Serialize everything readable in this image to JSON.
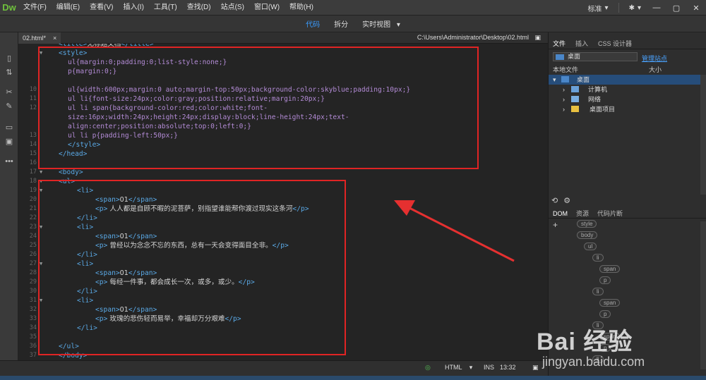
{
  "app": {
    "logo": "Dw"
  },
  "menu": [
    "文件(F)",
    "编辑(E)",
    "查看(V)",
    "插入(I)",
    "工具(T)",
    "查找(D)",
    "站点(S)",
    "窗口(W)",
    "帮助(H)"
  ],
  "toolbar": {
    "workspace": "标准",
    "workspace_arrow": "▾",
    "gear_arrow": "▾"
  },
  "window_controls": {
    "minimize": "—",
    "maximize": "▢",
    "close": "✕"
  },
  "views": {
    "code": "代码",
    "split": "拆分",
    "live": "实时视图",
    "live_arrow": "▾"
  },
  "document": {
    "tab": "02.html*",
    "tab_close": "×",
    "path": "C:\\Users\\Administrator\\Desktop\\02.html"
  },
  "code_lines": [
    {
      "n": "",
      "fold": "",
      "indent": 1,
      "parts": [
        {
          "c": "tag",
          "t": "<title>"
        },
        {
          "c": "txt",
          "t": "无标题文档"
        },
        {
          "c": "tag",
          "t": "</title>"
        }
      ]
    },
    {
      "n": "",
      "fold": "▼",
      "indent": 1,
      "parts": [
        {
          "c": "tag",
          "t": "<style>"
        }
      ]
    },
    {
      "n": "",
      "fold": "",
      "indent": 2,
      "parts": [
        {
          "c": "css",
          "t": "ul{margin:0;padding:0;list-style:none;}"
        }
      ]
    },
    {
      "n": "",
      "fold": "",
      "indent": 2,
      "parts": [
        {
          "c": "css",
          "t": "p{margin:0;}"
        }
      ]
    },
    {
      "n": "",
      "fold": "",
      "indent": 2,
      "parts": []
    },
    {
      "n": "10",
      "fold": "",
      "indent": 2,
      "parts": [
        {
          "c": "css",
          "t": "ul{width:600px;margin:0 auto;margin-top:50px;background-color:skyblue;padding:10px;}"
        }
      ]
    },
    {
      "n": "11",
      "fold": "",
      "indent": 2,
      "parts": [
        {
          "c": "css",
          "t": "ul li{font-size:24px;color:gray;position:relative;margin:20px;}"
        }
      ]
    },
    {
      "n": "12",
      "fold": "",
      "indent": 2,
      "parts": [
        {
          "c": "css",
          "t": "ul li span{background-color:red;color:white;font-"
        }
      ]
    },
    {
      "n": "",
      "fold": "",
      "indent": 2,
      "parts": [
        {
          "c": "css",
          "t": "size:16px;width:24px;height:24px;display:block;line-height:24px;text-"
        }
      ]
    },
    {
      "n": "",
      "fold": "",
      "indent": 2,
      "parts": [
        {
          "c": "css",
          "t": "align:center;position:absolute;top:0;left:0;}"
        }
      ]
    },
    {
      "n": "13",
      "fold": "",
      "indent": 2,
      "parts": [
        {
          "c": "css",
          "t": "ul li p{padding-left:50px;}"
        }
      ]
    },
    {
      "n": "14",
      "fold": "",
      "indent": 2,
      "parts": [
        {
          "c": "tag",
          "t": "</style>"
        }
      ]
    },
    {
      "n": "15",
      "fold": "",
      "indent": 1,
      "parts": [
        {
          "c": "tag",
          "t": "</head>"
        }
      ]
    },
    {
      "n": "16",
      "fold": "",
      "indent": 0,
      "parts": []
    },
    {
      "n": "17",
      "fold": "▼",
      "indent": 1,
      "parts": [
        {
          "c": "tag",
          "t": "<body>"
        }
      ]
    },
    {
      "n": "18",
      "fold": "▼",
      "indent": 1,
      "parts": [
        {
          "c": "tag",
          "t": "<ul>"
        }
      ]
    },
    {
      "n": "19",
      "fold": "▼",
      "indent": 3,
      "parts": [
        {
          "c": "tag",
          "t": "<li>"
        }
      ]
    },
    {
      "n": "20",
      "fold": "",
      "indent": 5,
      "parts": [
        {
          "c": "tag",
          "t": "<span>"
        },
        {
          "c": "txt",
          "t": "01"
        },
        {
          "c": "tag",
          "t": "</span>"
        }
      ]
    },
    {
      "n": "21",
      "fold": "",
      "indent": 5,
      "parts": [
        {
          "c": "tag",
          "t": "<p>"
        },
        {
          "c": "txt",
          "t": " 人人都是自顾不暇的泥菩萨，别指望谁能帮你渡过现实这条河"
        },
        {
          "c": "tag",
          "t": "</p>"
        }
      ]
    },
    {
      "n": "22",
      "fold": "",
      "indent": 3,
      "parts": [
        {
          "c": "tag",
          "t": "</li>"
        }
      ]
    },
    {
      "n": "23",
      "fold": "▼",
      "indent": 3,
      "parts": [
        {
          "c": "tag",
          "t": "<li>"
        }
      ]
    },
    {
      "n": "24",
      "fold": "",
      "indent": 5,
      "parts": [
        {
          "c": "tag",
          "t": "<span>"
        },
        {
          "c": "txt",
          "t": "01"
        },
        {
          "c": "tag",
          "t": "</span>"
        }
      ]
    },
    {
      "n": "25",
      "fold": "",
      "indent": 5,
      "parts": [
        {
          "c": "tag",
          "t": "<p>"
        },
        {
          "c": "txt",
          "t": " 曾经以为念念不忘的东西，总有一天会变得面目全非。"
        },
        {
          "c": "tag",
          "t": "</p>"
        }
      ]
    },
    {
      "n": "26",
      "fold": "",
      "indent": 3,
      "parts": [
        {
          "c": "tag",
          "t": "</li>"
        }
      ]
    },
    {
      "n": "27",
      "fold": "▼",
      "indent": 3,
      "parts": [
        {
          "c": "tag",
          "t": "<li>"
        }
      ]
    },
    {
      "n": "28",
      "fold": "",
      "indent": 5,
      "parts": [
        {
          "c": "tag",
          "t": "<span>"
        },
        {
          "c": "txt",
          "t": "01"
        },
        {
          "c": "tag",
          "t": "</span>"
        }
      ]
    },
    {
      "n": "29",
      "fold": "",
      "indent": 5,
      "parts": [
        {
          "c": "tag",
          "t": "<p>"
        },
        {
          "c": "txt",
          "t": "  每经一件事，都会成长一次，或多，或少。"
        },
        {
          "c": "tag",
          "t": "</p>"
        }
      ]
    },
    {
      "n": "30",
      "fold": "",
      "indent": 3,
      "parts": [
        {
          "c": "tag",
          "t": "</li>"
        }
      ]
    },
    {
      "n": "31",
      "fold": "▼",
      "indent": 3,
      "parts": [
        {
          "c": "tag",
          "t": "<li>"
        }
      ]
    },
    {
      "n": "32",
      "fold": "",
      "indent": 5,
      "parts": [
        {
          "c": "tag",
          "t": "<span>"
        },
        {
          "c": "txt",
          "t": "01"
        },
        {
          "c": "tag",
          "t": "</span>"
        }
      ]
    },
    {
      "n": "33",
      "fold": "",
      "indent": 5,
      "parts": [
        {
          "c": "tag",
          "t": "<p>"
        },
        {
          "c": "txt",
          "t": "  玫瑰的悲伤轻而易举，幸福却万分艰难"
        },
        {
          "c": "tag",
          "t": "</p>"
        }
      ]
    },
    {
      "n": "34",
      "fold": "",
      "indent": 3,
      "parts": [
        {
          "c": "tag",
          "t": "</li>"
        }
      ]
    },
    {
      "n": "35",
      "fold": "",
      "indent": 0,
      "parts": []
    },
    {
      "n": "36",
      "fold": "",
      "indent": 1,
      "parts": [
        {
          "c": "tag",
          "t": "</ul>"
        }
      ]
    },
    {
      "n": "37",
      "fold": "",
      "indent": 1,
      "parts": [
        {
          "c": "tag",
          "t": "</body>"
        }
      ]
    }
  ],
  "status": {
    "mode": "HTML",
    "ins": "INS",
    "position": "13:32"
  },
  "files_panel": {
    "tabs": [
      "文件",
      "插入",
      "CSS 设计器"
    ],
    "site": "桌面",
    "manage": "管理站点",
    "col_local": "本地文件",
    "col_size": "大小",
    "tree": [
      {
        "label": "桌面",
        "arrow": "▾"
      },
      {
        "label": "计算机",
        "arrow": "›"
      },
      {
        "label": "网络",
        "arrow": "›"
      },
      {
        "label": "桌面项目",
        "arrow": "›"
      }
    ]
  },
  "dom_panel": {
    "tabs": [
      "DOM",
      "资源",
      "代码片断"
    ],
    "add": "+",
    "nodes": [
      "style",
      "body",
      "ul",
      "li",
      "span",
      "p",
      "li",
      "span",
      "p",
      "li",
      "span",
      "p",
      "li"
    ]
  },
  "watermark": {
    "logo": "Bai 经验",
    "url": "jingyan.baidu.com"
  }
}
